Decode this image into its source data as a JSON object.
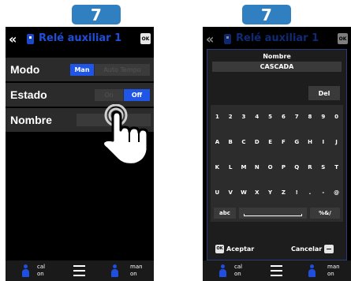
{
  "left": {
    "step": "7",
    "title": "Relé auxiliar 1",
    "ok": "OK",
    "rows": [
      {
        "label": "Modo",
        "options": [
          "Man",
          "Auto Tempo"
        ],
        "selected": "Man"
      },
      {
        "label": "Estado",
        "options": [
          "On",
          "Off"
        ],
        "selected": "Off"
      },
      {
        "label": "Nombre"
      }
    ]
  },
  "right": {
    "step": "7",
    "title": "Relé auxiliar 1",
    "ok": "OK",
    "field_label": "Nombre",
    "field_value": "CASCADA",
    "del_key": "Del",
    "key_rows": [
      [
        "1",
        "2",
        "3",
        "4",
        "5",
        "6",
        "7",
        "8",
        "9",
        "0"
      ],
      [
        "A",
        "B",
        "C",
        "D",
        "E",
        "F",
        "G",
        "H",
        "I",
        "J"
      ],
      [
        "K",
        "L",
        "M",
        "N",
        "O",
        "P",
        "Q",
        "R",
        "S",
        "T"
      ],
      [
        "U",
        "V",
        "W",
        "X",
        "Y",
        "Z",
        "!",
        ".",
        "-",
        "@"
      ]
    ],
    "abc_key": "abc",
    "symbols_key": "%&/",
    "accept_label": "Aceptar",
    "cancel_label": "Cancelar"
  },
  "bottom_bar": {
    "left_text": [
      "cal",
      "on"
    ],
    "right_text": [
      "man",
      "on"
    ]
  },
  "colors": {
    "accent": "#1f56e8",
    "title_blue": "#1e4fd8",
    "badge": "#2f7fc1"
  },
  "icons": [
    "back-chevrons-icon",
    "device-icon",
    "ok-icon",
    "person-icon",
    "list-icon",
    "erase-icon",
    "touch-hand-icon"
  ]
}
